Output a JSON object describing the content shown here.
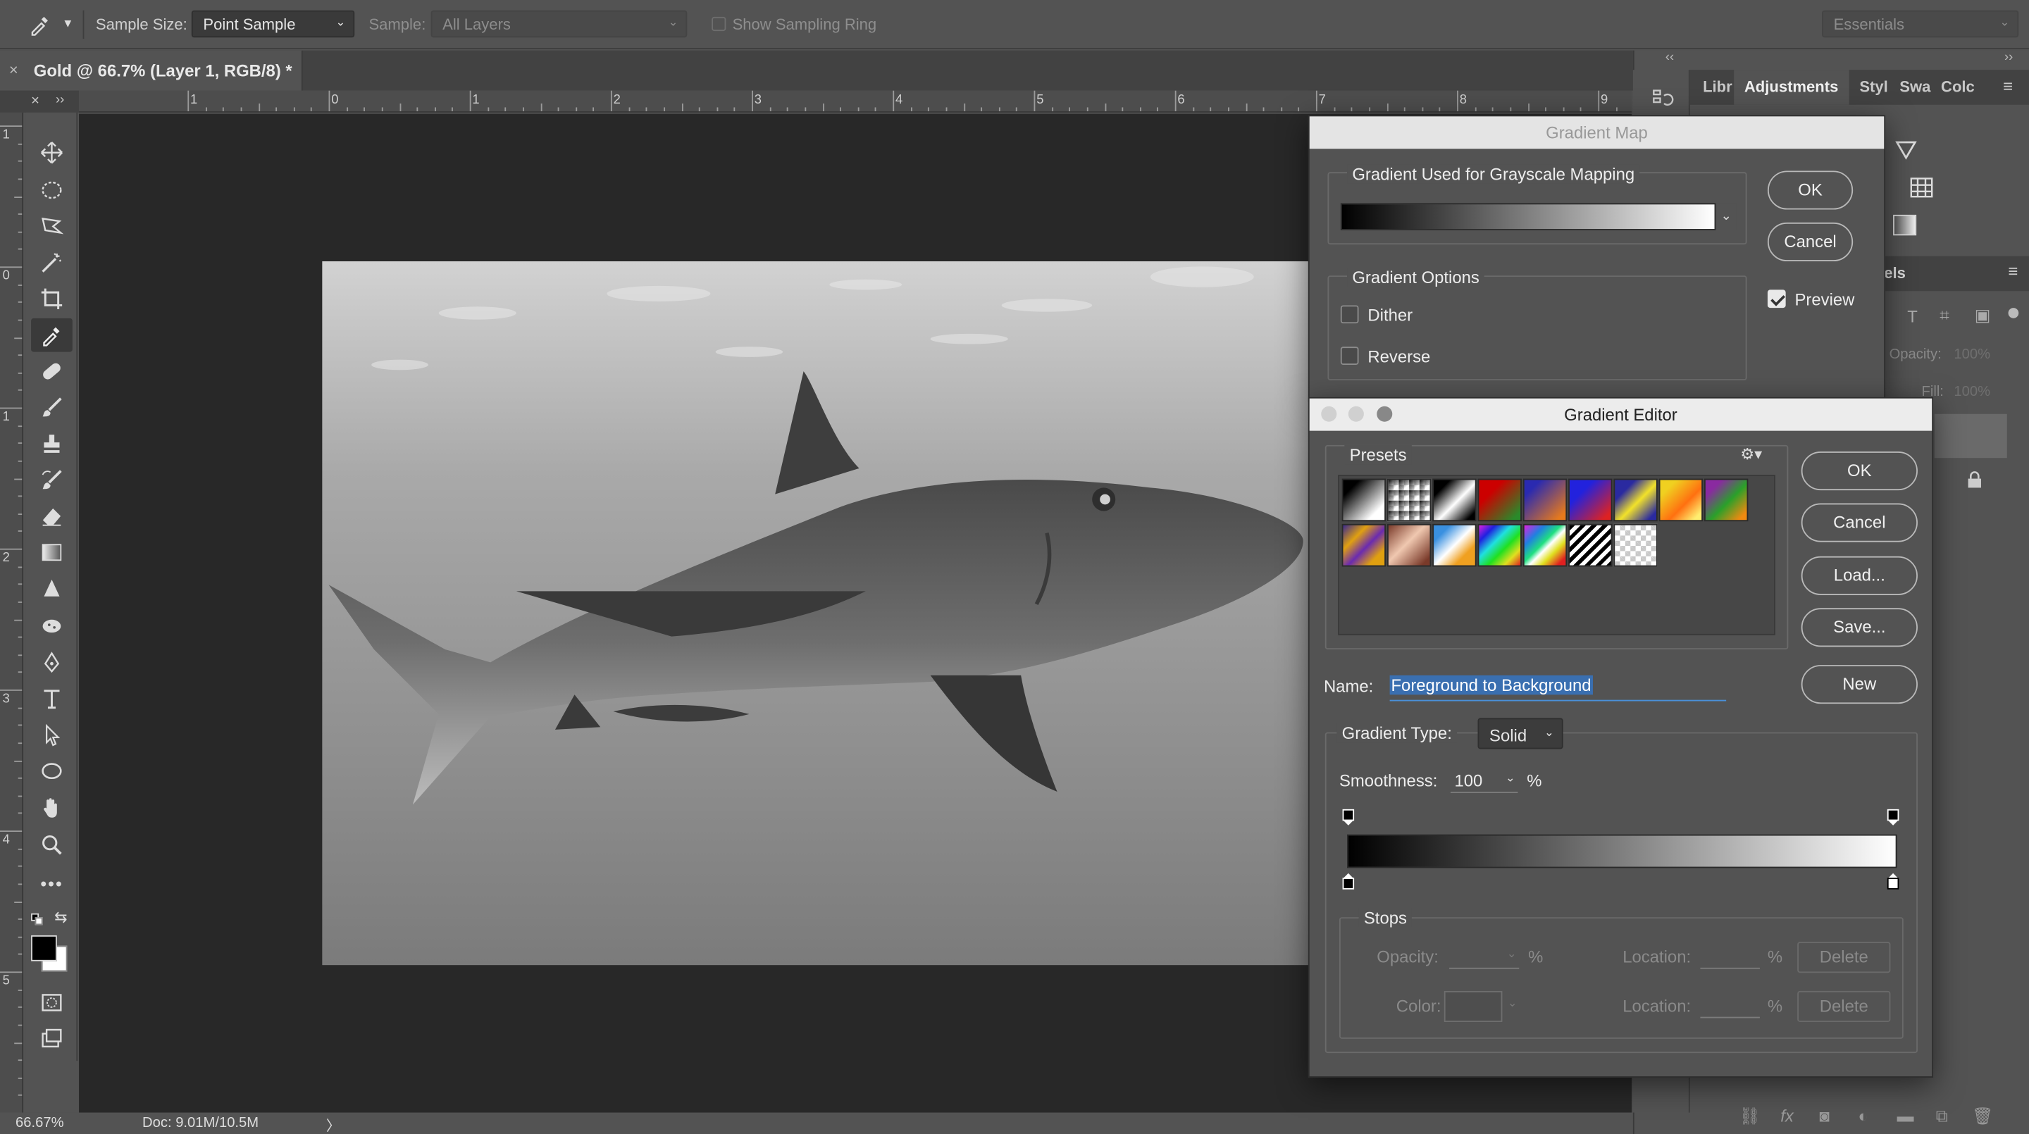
{
  "options_bar": {
    "sample_size_label": "Sample Size:",
    "sample_size_value": "Point Sample",
    "sample_label": "Sample:",
    "sample_value": "All Layers",
    "show_sampling_ring": "Show Sampling Ring",
    "workspace": "Essentials"
  },
  "document_tab": {
    "close": "×",
    "title": "Gold @ 66.7% (Layer 1, RGB/8) *"
  },
  "rulers": {
    "horizontal": [
      "1",
      "0",
      "1",
      "2",
      "3",
      "4",
      "5",
      "6",
      "7",
      "8",
      "9"
    ],
    "vertical": [
      "1",
      "0",
      "1",
      "2",
      "3",
      "4",
      "5"
    ]
  },
  "status_bar": {
    "zoom": "66.67%",
    "doc": "Doc: 9.01M/10.5M",
    "arrow": "〉"
  },
  "panels": {
    "tabs": [
      "Libr",
      "Adjustments",
      "Styl",
      "Swa",
      "Colc"
    ],
    "layers_tab": "els",
    "opacity_label": "Opacity:",
    "opacity_value": "100%",
    "fill_label": "Fill:",
    "fill_value": "100%",
    "collapse": "‹‹",
    "expand": "››"
  },
  "gradient_map": {
    "title": "Gradient Map",
    "mapping_group": "Gradient Used for Grayscale Mapping",
    "options_group": "Gradient Options",
    "dither": "Dither",
    "reverse": "Reverse",
    "ok": "OK",
    "cancel": "Cancel",
    "preview": "Preview",
    "preview_checked": true
  },
  "gradient_editor": {
    "title": "Gradient Editor",
    "presets_label": "Presets",
    "ok": "OK",
    "cancel": "Cancel",
    "load": "Load...",
    "save": "Save...",
    "new": "New",
    "name_label": "Name:",
    "name_value": "Foreground to Background",
    "gradient_type_label": "Gradient Type:",
    "gradient_type_value": "Solid",
    "smoothness_label": "Smoothness:",
    "smoothness_value": "100",
    "percent": "%",
    "stops_label": "Stops",
    "opacity_label": "Opacity:",
    "location_label": "Location:",
    "color_label": "Color:",
    "delete": "Delete"
  }
}
